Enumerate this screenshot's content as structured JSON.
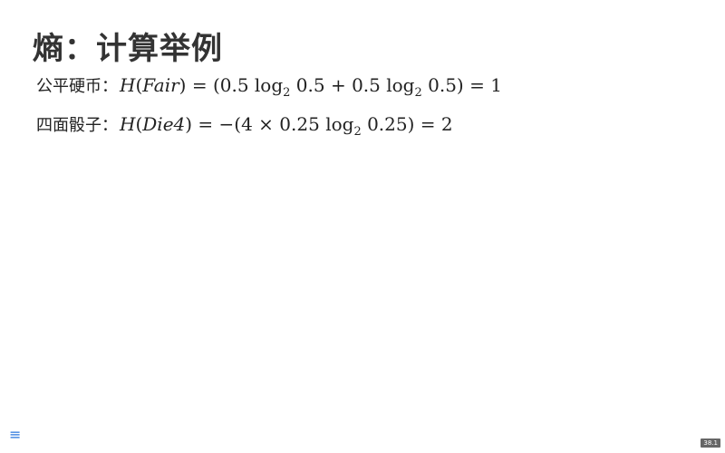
{
  "slide": {
    "title": "熵：计算举例",
    "rows": [
      {
        "label": "公平硬币：",
        "math": {
          "fn": "H",
          "arg": "Fair",
          "expr_a": ") = (0.5 log",
          "base_a": "2",
          "expr_b": " 0.5 + 0.5 log",
          "base_b": "2",
          "expr_c": " 0.5) = 1"
        }
      },
      {
        "label": "四面骰子：",
        "math": {
          "fn": "H",
          "arg": "Die4",
          "expr_a": ") = −(4 × 0.25 log",
          "base_a": "2",
          "expr_b": " 0.25) = 2"
        }
      }
    ]
  },
  "nav": {
    "menu_icon": "≡",
    "page_number": "38.1"
  }
}
